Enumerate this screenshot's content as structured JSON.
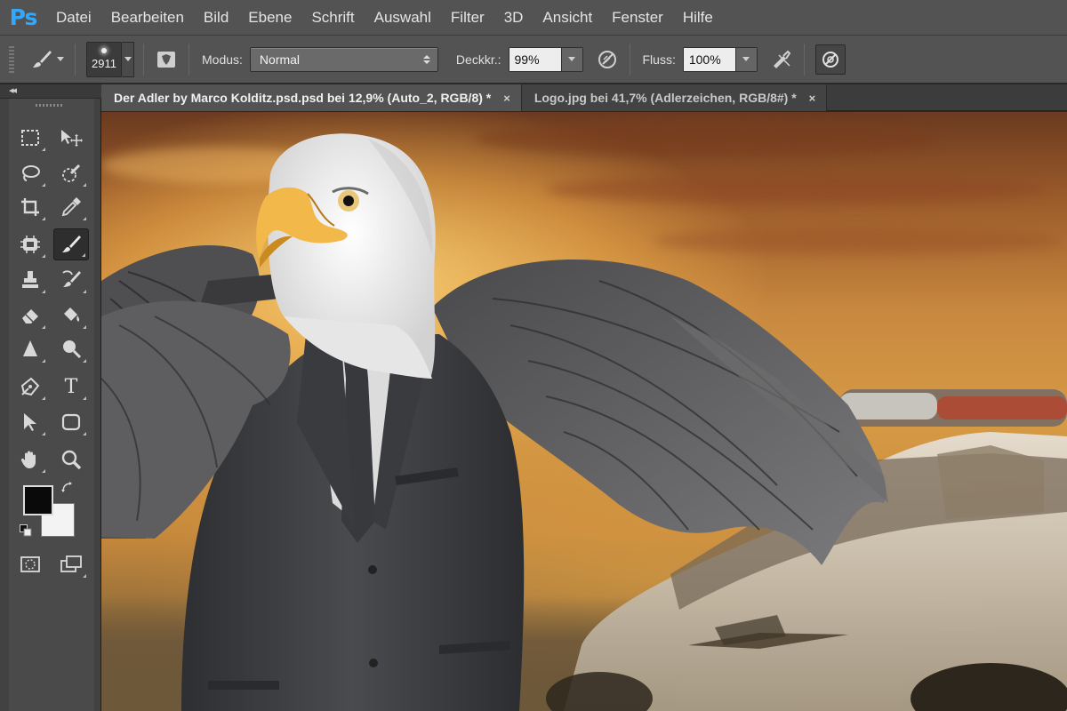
{
  "app": {
    "logo": "Ps",
    "menu": [
      "Datei",
      "Bearbeiten",
      "Bild",
      "Ebene",
      "Schrift",
      "Auswahl",
      "Filter",
      "3D",
      "Ansicht",
      "Fenster",
      "Hilfe"
    ]
  },
  "options_bar": {
    "brush_size": "2911",
    "mode_label": "Modus:",
    "mode_value": "Normal",
    "opacity_label": "Deckkr.:",
    "opacity_value": "99%",
    "flow_label": "Fluss:",
    "flow_value": "100%"
  },
  "tabs": [
    {
      "label": "Der Adler by Marco Kolditz.psd.psd bei 12,9% (Auto_2, RGB/8) *",
      "close": "×",
      "active": true
    },
    {
      "label": "Logo.jpg bei 41,7% (Adlerzeichen, RGB/8#) *",
      "close": "×",
      "active": false
    }
  ],
  "toolbox": {
    "collapse": "◂◂",
    "foreground_color": "#0a0a0a",
    "background_color": "#f3f3f3",
    "tools": [
      {
        "name": "rectangular-marquee-icon"
      },
      {
        "name": "move-icon"
      },
      {
        "name": "lasso-icon"
      },
      {
        "name": "quick-selection-icon"
      },
      {
        "name": "crop-icon"
      },
      {
        "name": "eyedropper-icon"
      },
      {
        "name": "spot-healing-icon"
      },
      {
        "name": "brush-icon",
        "selected": true
      },
      {
        "name": "clone-stamp-icon"
      },
      {
        "name": "history-brush-icon"
      },
      {
        "name": "eraser-icon"
      },
      {
        "name": "paint-bucket-icon"
      },
      {
        "name": "blur-icon"
      },
      {
        "name": "dodge-icon"
      },
      {
        "name": "pen-icon"
      },
      {
        "name": "type-icon",
        "glyph": "T"
      },
      {
        "name": "path-selection-icon"
      },
      {
        "name": "rounded-rectangle-icon"
      },
      {
        "name": "hand-icon"
      },
      {
        "name": "zoom-icon"
      }
    ]
  },
  "canvas": {
    "description_colors": {
      "sky": "#c98a40",
      "suit": "#3a3a3c",
      "car": "#d8d2c8"
    }
  }
}
